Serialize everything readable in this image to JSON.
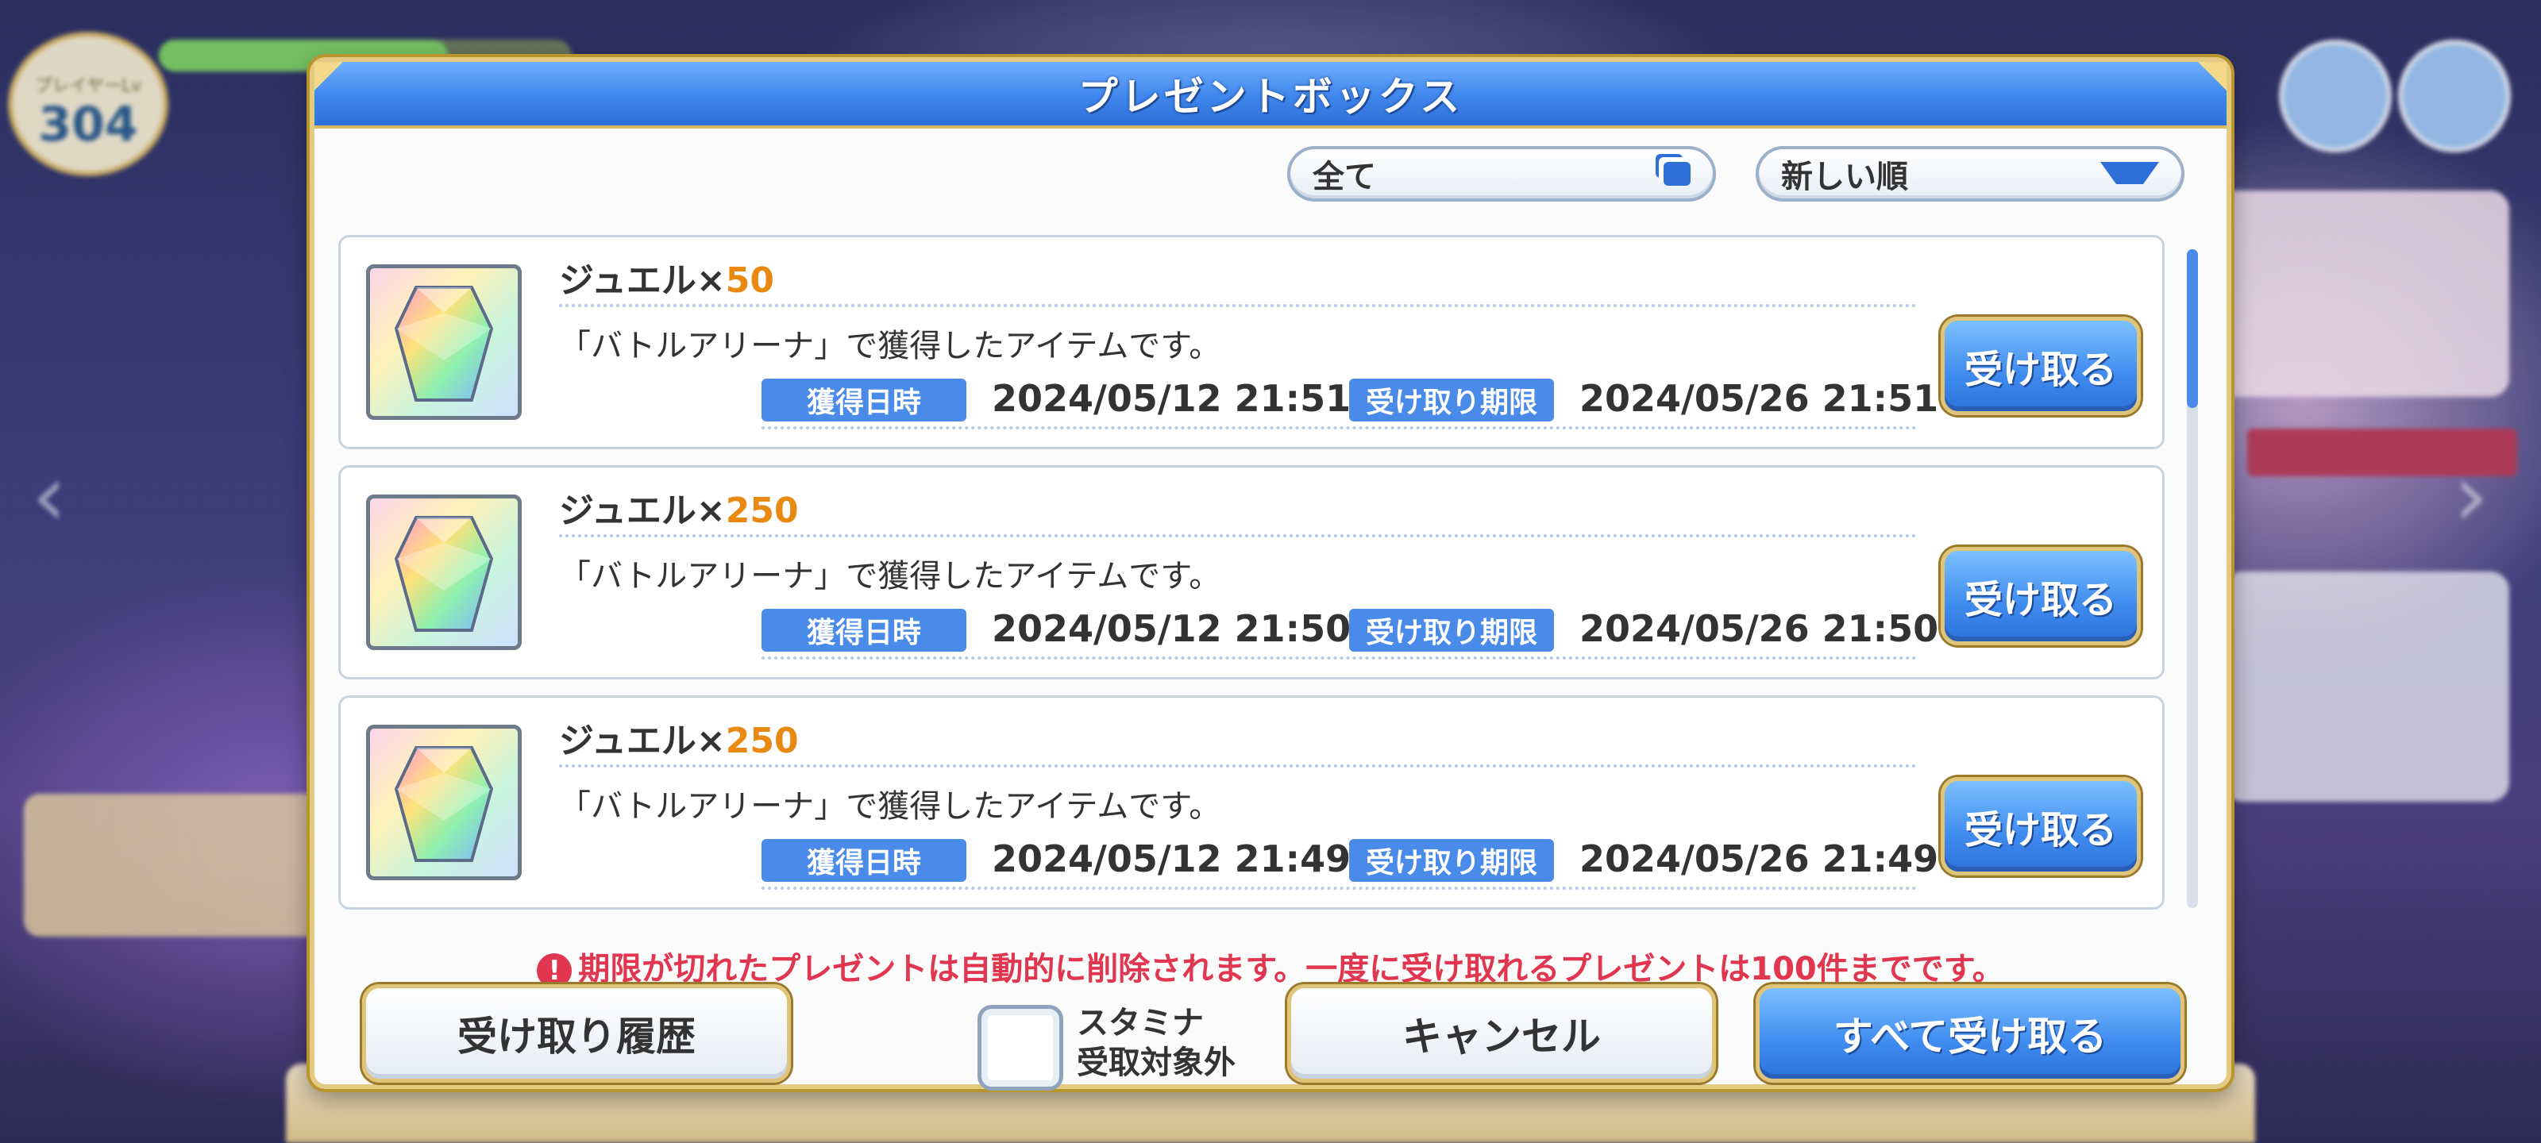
{
  "background": {
    "player_level_label": "プレイヤーLv",
    "player_level": "304"
  },
  "dialog": {
    "title": "プレゼントボックス",
    "filter": {
      "selected": "全て",
      "icon": "copy-icon"
    },
    "sort": {
      "selected": "新しい順",
      "icon": "triangle-down-icon"
    },
    "items": [
      {
        "name": "ジュエル×",
        "quantity": "50",
        "description": "「バトルアリーナ」で獲得したアイテムです。",
        "acquired_label": "獲得日時",
        "acquired": "2024/05/12 21:51",
        "deadline_label": "受け取り期限",
        "deadline": "2024/05/26 21:51",
        "button": "受け取る"
      },
      {
        "name": "ジュエル×",
        "quantity": "250",
        "description": "「バトルアリーナ」で獲得したアイテムです。",
        "acquired_label": "獲得日時",
        "acquired": "2024/05/12 21:50",
        "deadline_label": "受け取り期限",
        "deadline": "2024/05/26 21:50",
        "button": "受け取る"
      },
      {
        "name": "ジュエル×",
        "quantity": "250",
        "description": "「バトルアリーナ」で獲得したアイテムです。",
        "acquired_label": "獲得日時",
        "acquired": "2024/05/12 21:49",
        "deadline_label": "受け取り期限",
        "deadline": "2024/05/26 21:49",
        "button": "受け取る"
      }
    ],
    "notice": "期限が切れたプレゼントは自動的に削除されます。一度に受け取れるプレゼントは100件までです。",
    "notice_icon": "!",
    "buttons": {
      "history": "受け取り履歴",
      "stamina_line1": "スタミナ",
      "stamina_line2": "受取対象外",
      "cancel": "キャンセル",
      "receive_all": "すべて受け取る"
    }
  },
  "colors": {
    "header_blue": "#3f86ec",
    "quantity_orange": "#e88a12",
    "notice_red": "#e0364f",
    "frame_gold": "#e0c47a"
  }
}
